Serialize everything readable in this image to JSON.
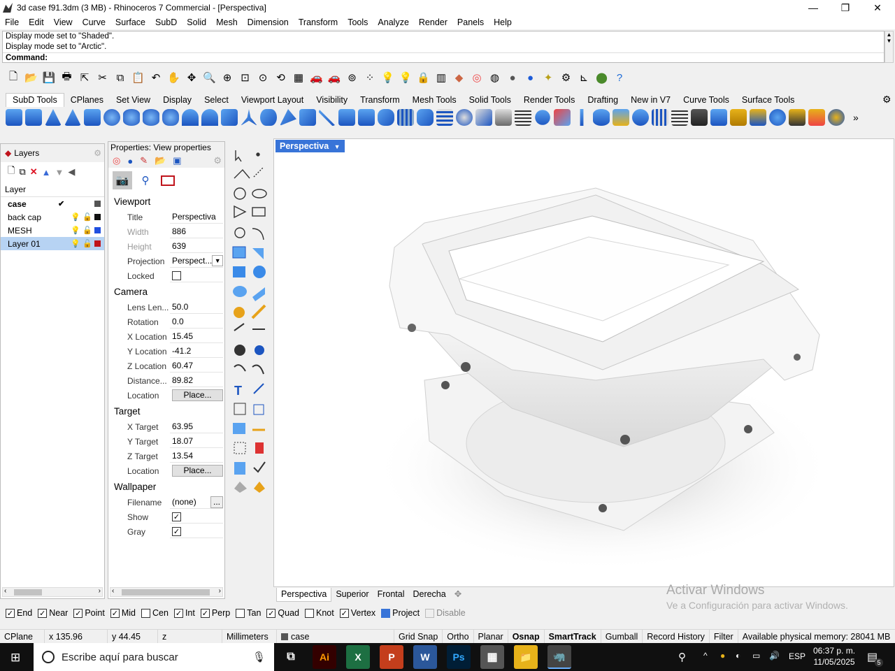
{
  "window": {
    "title": "3d case f91.3dm (3 MB) - Rhinoceros 7 Commercial - [Perspectiva]",
    "min": "—",
    "max": "❐",
    "close": "✕"
  },
  "menu": [
    "File",
    "Edit",
    "View",
    "Curve",
    "Surface",
    "SubD",
    "Solid",
    "Mesh",
    "Dimension",
    "Transform",
    "Tools",
    "Analyze",
    "Render",
    "Panels",
    "Help"
  ],
  "command": {
    "line1": "Display mode set to \"Shaded\".",
    "line2": "Display mode set to \"Arctic\".",
    "prompt": "Command:"
  },
  "toolbar_tabs": [
    "SubD Tools",
    "CPlanes",
    "Set View",
    "Display",
    "Select",
    "Viewport Layout",
    "Visibility",
    "Transform",
    "Mesh Tools",
    "Solid Tools",
    "Render Tools",
    "Drafting",
    "New in V7",
    "Curve Tools",
    "Surface Tools"
  ],
  "layers": {
    "tab": "Layers",
    "header": "Layer",
    "items": [
      {
        "name": "case",
        "current": true,
        "color": "#555555"
      },
      {
        "name": "back cap",
        "current": false,
        "color": "#111111"
      },
      {
        "name": "MESH",
        "current": false,
        "color": "#1f4fe0"
      },
      {
        "name": "Layer 01",
        "current": false,
        "color": "#c0141c"
      }
    ]
  },
  "properties": {
    "header": "Properties: View properties",
    "viewport_section": "Viewport",
    "title_label": "Title",
    "title_value": "Perspectiva",
    "width_label": "Width",
    "width_value": "886",
    "height_label": "Height",
    "height_value": "639",
    "projection_label": "Projection",
    "projection_value": "Perspect...",
    "locked_label": "Locked",
    "camera_section": "Camera",
    "lens_label": "Lens Len...",
    "lens_value": "50.0",
    "rotation_label": "Rotation",
    "rotation_value": "0.0",
    "xloc_label": "X Location",
    "xloc_value": "15.45",
    "yloc_label": "Y Location",
    "yloc_value": "-41.2",
    "zloc_label": "Z Location",
    "zloc_value": "60.47",
    "distance_label": "Distance...",
    "distance_value": "89.82",
    "location_label": "Location",
    "place_button": "Place...",
    "target_section": "Target",
    "xtarget_label": "X Target",
    "xtarget_value": "63.95",
    "ytarget_label": "Y Target",
    "ytarget_value": "18.07",
    "ztarget_label": "Z Target",
    "ztarget_value": "13.54",
    "wallpaper_section": "Wallpaper",
    "filename_label": "Filename",
    "filename_value": "(none)",
    "browse_button": "...",
    "show_label": "Show",
    "gray_label": "Gray"
  },
  "viewport": {
    "active_tab": "Perspectiva",
    "tabs": [
      "Perspectiva",
      "Superior",
      "Frontal",
      "Derecha"
    ],
    "add_tab": "✥"
  },
  "watermark": {
    "line1": "Activar Windows",
    "line2": "Ve a Configuración para activar Windows."
  },
  "osnap": [
    {
      "label": "End",
      "checked": true
    },
    {
      "label": "Near",
      "checked": true
    },
    {
      "label": "Point",
      "checked": true
    },
    {
      "label": "Mid",
      "checked": true
    },
    {
      "label": "Cen",
      "checked": false
    },
    {
      "label": "Int",
      "checked": true
    },
    {
      "label": "Perp",
      "checked": true
    },
    {
      "label": "Tan",
      "checked": false
    },
    {
      "label": "Quad",
      "checked": true
    },
    {
      "label": "Knot",
      "checked": false
    },
    {
      "label": "Vertex",
      "checked": true
    },
    {
      "label": "Project",
      "checked": true
    },
    {
      "label": "Disable",
      "checked": false
    }
  ],
  "status": {
    "cplane": "CPlane",
    "x": "x 135.96",
    "y": "y 44.45",
    "z": "z",
    "units": "Millimeters",
    "layer": "case",
    "grid_snap": "Grid Snap",
    "ortho": "Ortho",
    "planar": "Planar",
    "osnap": "Osnap",
    "smarttrack": "SmartTrack",
    "gumball": "Gumball",
    "record_history": "Record History",
    "filter": "Filter",
    "memory": "Available physical memory: 28041 MB"
  },
  "taskbar": {
    "search_placeholder": "Escribe aquí para buscar",
    "lang": "ESP",
    "time": "06:37 p. m.",
    "date": "11/05/2025",
    "notif_count": "5"
  }
}
